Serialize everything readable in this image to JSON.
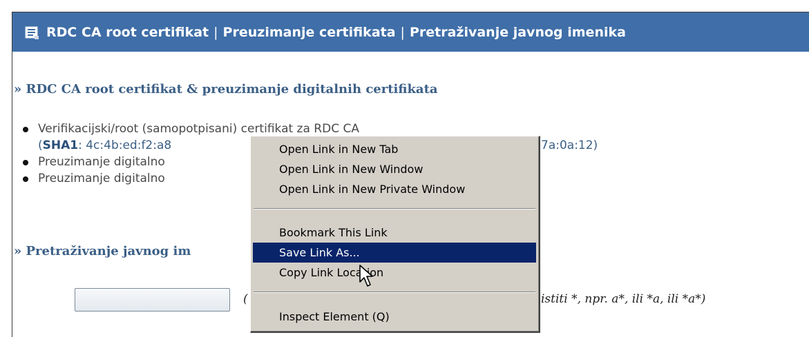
{
  "header": {
    "links": [
      "RDC CA root certifikat",
      "Preuzimanje certifikata",
      "Pretraživanje javnog imenika"
    ],
    "separator": "|",
    "icon": "document-list-icon"
  },
  "section1": {
    "title": "» RDC CA root certifikat & preuzimanje digitalnih certifikata",
    "items": [
      "Verifikacijski/root (samopotpisani) certifikat za RDC CA",
      "Preuzimanje digitalno",
      "Preuzimanje digitalno"
    ],
    "hash_open": "(",
    "hash_label": "SHA1",
    "hash_value": ": 4c:4b:ed:f2:a8",
    "hash_tail": "7a:0a:12)"
  },
  "section2": {
    "title": "» Pretraživanje javnog im",
    "hint_prefix": "(",
    "hint": "istiti *, npr. a*, ili *a, ili *a*)"
  },
  "context_menu": {
    "items": [
      "Open Link in New Tab",
      "Open Link in New Window",
      "Open Link in New Private Window",
      "Bookmark This Link",
      "Save Link As...",
      "Copy Link Location",
      "Inspect Element (Q)"
    ],
    "active_index": 4,
    "active_bg": "#0a246a",
    "menu_bg": "#d4d0c8"
  },
  "colors": {
    "header_bg": "#3f6ea8",
    "heading_text": "#3b5f86"
  }
}
